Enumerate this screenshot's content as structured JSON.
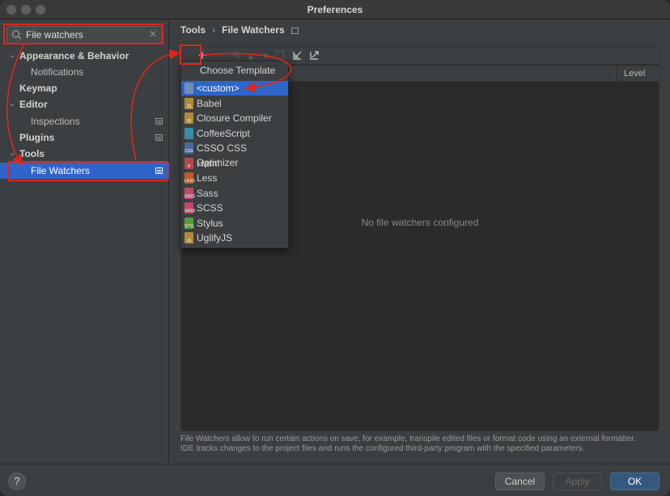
{
  "window": {
    "title": "Preferences"
  },
  "search": {
    "value": "File watchers",
    "icon": "search-icon",
    "clear_icon": "clear-icon"
  },
  "sidebar": {
    "items": [
      {
        "label": "Appearance & Behavior",
        "bold": true,
        "expanded": true
      },
      {
        "label": "Notifications",
        "bold": false
      },
      {
        "label": "Keymap",
        "bold": true
      },
      {
        "label": "Editor",
        "bold": true,
        "expanded": true
      },
      {
        "label": "Inspections",
        "bold": false
      },
      {
        "label": "Plugins",
        "bold": true
      },
      {
        "label": "Tools",
        "bold": true,
        "expanded": true
      },
      {
        "label": "File Watchers",
        "bold": false,
        "selected": true
      }
    ]
  },
  "breadcrumb": {
    "parent": "Tools",
    "separator": "›",
    "current": "File Watchers"
  },
  "toolbar": {
    "add_icon": "plus-icon",
    "edit_icon": "pencil-icon",
    "up_icon": "arrow-up-icon",
    "down_icon": "arrow-down-icon",
    "copy_icon": "copy-icon",
    "import_icon": "import-icon",
    "export_icon": "export-icon"
  },
  "table": {
    "level_header": "Level",
    "empty_text": "No file watchers configured"
  },
  "popup": {
    "title": "Choose Template",
    "items": [
      {
        "label": "<custom>",
        "badge": "",
        "color": "#6f8fb7",
        "selected": true
      },
      {
        "label": "Babel",
        "badge": "JS",
        "color": "#b08a3a"
      },
      {
        "label": "Closure Compiler",
        "badge": "JS",
        "color": "#b08a3a"
      },
      {
        "label": "CoffeeScript",
        "badge": "",
        "color": "#3b8aa8"
      },
      {
        "label": "CSSO CSS Optimizer",
        "badge": "CSS",
        "color": "#4a6a9a"
      },
      {
        "label": "Haml",
        "badge": "H",
        "color": "#b04a4a"
      },
      {
        "label": "Less",
        "badge": "LESS",
        "color": "#c05a2a"
      },
      {
        "label": "Sass",
        "badge": "SASS",
        "color": "#c04a6a"
      },
      {
        "label": "SCSS",
        "badge": "SASS",
        "color": "#c04a6a"
      },
      {
        "label": "Stylus",
        "badge": "STYL",
        "color": "#5a9a3a"
      },
      {
        "label": "UglifyJS",
        "badge": "JS",
        "color": "#b08a3a"
      }
    ]
  },
  "description": "File Watchers allow to run certain actions on save, for example, transpile edited files or format code using an external formatter. IDE tracks changes to the project files and runs the configured third-party program with the specified parameters.",
  "buttons": {
    "help": "?",
    "cancel": "Cancel",
    "apply": "Apply",
    "ok": "OK"
  },
  "annotation_color": "#e0261b"
}
